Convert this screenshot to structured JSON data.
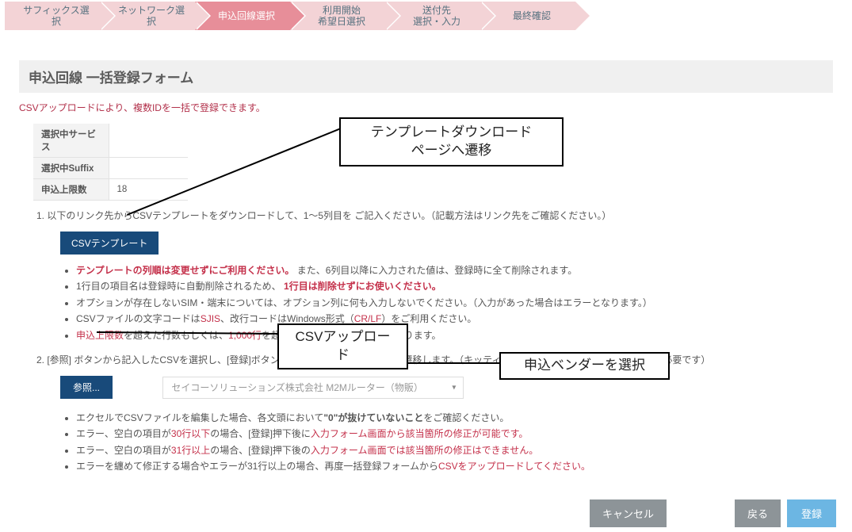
{
  "steps": [
    {
      "label": "サフィックス選択"
    },
    {
      "label": "ネットワーク選択"
    },
    {
      "label": "申込回線選択",
      "active": true
    },
    {
      "label": "利用開始\n希望日選択"
    },
    {
      "label": "送付先\n選択・入力"
    },
    {
      "label": "最終確認"
    }
  ],
  "heading": "申込回線 一括登録フォーム",
  "subdesc": "CSVアップロードにより、複数IDを一括で登録できます。",
  "info_rows": [
    {
      "label": "選択中サービス",
      "value": ""
    },
    {
      "label": "選択中Suffix",
      "value": ""
    },
    {
      "label": "申込上限数",
      "value": "18"
    }
  ],
  "step1_text": "1. 以下のリンク先からCSVテンプレートをダウンロードして、1～5列目を ご記入ください。（記載方法はリンク先をご確認ください。）",
  "csv_template_btn": "CSVテンプレート",
  "step1_notes": [
    {
      "pre_red_bold": "テンプレートの列順は変更せずにご利用ください。",
      "post": "また、6列目以降に入力された値は、登録時に全て削除されます。"
    },
    {
      "pre": "1行目の項目名は登録時に自動削除されるため、",
      "mid_red_bold": "1行目は削除せずにお使いください。"
    },
    {
      "plain": "オプションが存在しないSIM・端末については、オプション列に何も入力しないでください。（入力があった場合はエラーとなります。）"
    },
    {
      "pre": "CSVファイルの文字コードは",
      "r1": "SJIS",
      "mid": "、改行コードはWindows形式（",
      "r2": "CR/LF",
      "post": "）をご利用ください。"
    },
    {
      "r1": "申込上限数",
      "mid1": "を超えた行数もしくは、",
      "r2": "1,000行",
      "post": "を超えた行数の場合はエラーとなります。"
    }
  ],
  "step2_text": "2. [参照] ボタンから記入したCSVを選択し、[登録]ボタンを押すと入力フォーム画面へ遷移します。（キッティングありの場合は機器ベンダー選択が必要です）",
  "browse_btn": "参照...",
  "vendor_selected": "セイコーソリューションズ株式会社 M2Mルーター（物販）",
  "step2_notes": [
    {
      "pre": "エクセルでCSVファイルを編集した場合、各文頭において",
      "bold": "\"0\"が抜けていないこと",
      "post": "をご確認ください。"
    },
    {
      "pre": "エラー、空白の項目が",
      "r1": "30行以下",
      "mid": "の場合、[登録]押下後に",
      "r2": "入力フォーム画面から該当箇所の修正が可能です。"
    },
    {
      "pre": "エラー、空白の項目が",
      "r1": "31行以上",
      "mid": "の場合、[登録]押下後の",
      "r2": "入力フォーム画面では該当箇所の修正はできません。"
    },
    {
      "pre": "エラーを纏めて修正する場合やエラーが31行以上の場合、再度一括登録フォームから",
      "r1": "CSVをアップロードしてください。"
    }
  ],
  "footer": {
    "cancel": "キャンセル",
    "back": "戻る",
    "register": "登録"
  },
  "callouts": {
    "template": "テンプレートダウンロード\nページへ遷移",
    "upload": "CSVアップロード",
    "vendor": "申込ベンダーを選択"
  }
}
